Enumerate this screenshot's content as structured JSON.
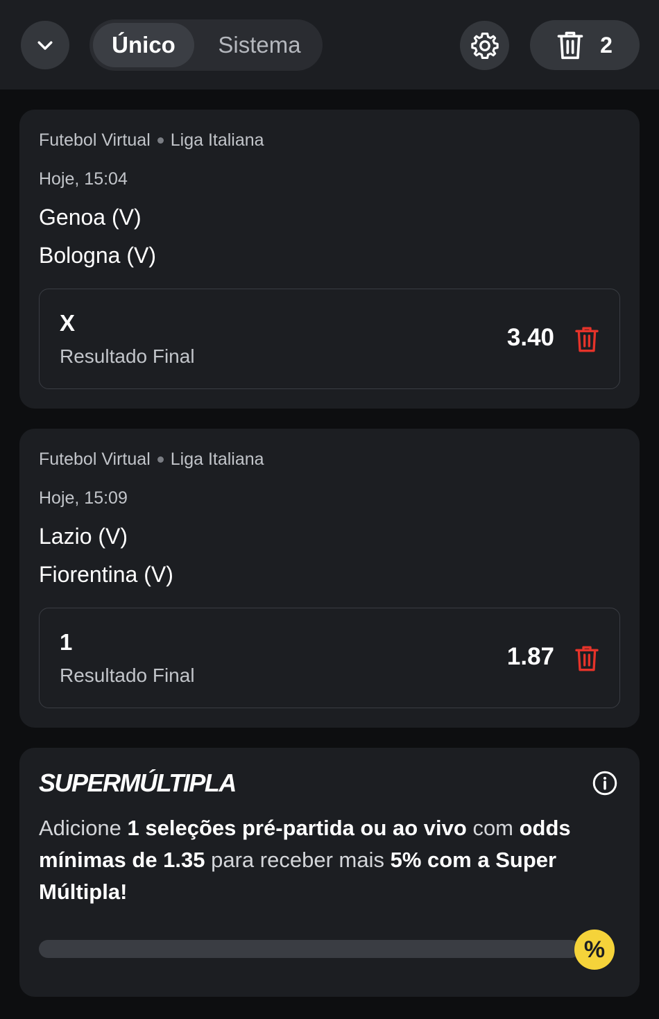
{
  "header": {
    "collapse_icon": "chevron-down-icon",
    "tabs": [
      {
        "label": "Único",
        "active": true
      },
      {
        "label": "Sistema",
        "active": false
      }
    ],
    "settings_icon": "gear-icon",
    "clear_icon": "trash-icon",
    "selection_count": "2"
  },
  "bets": [
    {
      "sport": "Futebol Virtual",
      "league": "Liga Italiana",
      "time": "Hoje, 15:04",
      "home": "Genoa (V)",
      "away": "Bologna (V)",
      "pick": "X",
      "market": "Resultado Final",
      "odds": "3.40"
    },
    {
      "sport": "Futebol Virtual",
      "league": "Liga Italiana",
      "time": "Hoje, 15:09",
      "home": "Lazio (V)",
      "away": "Fiorentina (V)",
      "pick": "1",
      "market": "Resultado Final",
      "odds": "1.87"
    }
  ],
  "promo": {
    "title": "SUPERMÚLTIPLA",
    "text_parts": [
      {
        "t": "Adicione ",
        "bold": false
      },
      {
        "t": "1 seleções pré-partida ou ao vivo",
        "bold": true
      },
      {
        "t": " com ",
        "bold": false
      },
      {
        "t": "odds mínimas de 1.35",
        "bold": true
      },
      {
        "t": " para receber mais ",
        "bold": false
      },
      {
        "t": "5% com a Super Múltipla!",
        "bold": true
      }
    ],
    "progress": 0,
    "badge": "%"
  },
  "colors": {
    "accent_red": "#e5332a",
    "promo_yellow": "#f5d33a",
    "card_bg": "#1c1e22"
  }
}
